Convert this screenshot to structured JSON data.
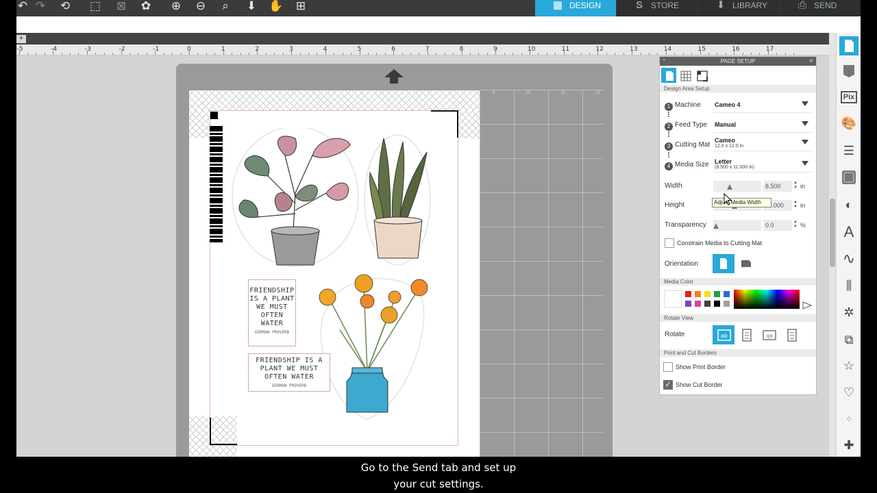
{
  "nav_tabs": [
    {
      "label": "DESIGN",
      "icon": "grid-icon",
      "active": true
    },
    {
      "label": "STORE",
      "icon": "store-s-icon",
      "active": false
    },
    {
      "label": "LIBRARY",
      "icon": "library-icon",
      "active": false
    },
    {
      "label": "SEND",
      "icon": "send-icon",
      "active": false
    }
  ],
  "toolbar_icons": [
    "undo-icon",
    "redo-icon",
    "refresh-icon",
    "select-icon",
    "deselect-icon",
    "paint-icon",
    "zoom-in-icon",
    "zoom-out-icon",
    "zoom-fit-icon",
    "move-down-icon",
    "pan-hand-icon",
    "add-page-icon"
  ],
  "ruler_labels": [
    "-5",
    "-4",
    "-3",
    "-2",
    "-1",
    "0",
    "1",
    "2",
    "3",
    "4",
    "5",
    "6",
    "7",
    "8",
    "9",
    "10",
    "11",
    "12",
    "13",
    "14",
    "15",
    "16",
    "17"
  ],
  "mat_grid_labels": [
    "9",
    "10",
    "11",
    "12"
  ],
  "artwork": {
    "quote_tall": {
      "text": "FRIENDSHIP IS A PLANT WE MUST OFTEN WATER",
      "author": "GERMAN PROVERB"
    },
    "quote_wide": {
      "text": "FRIENDSHIP IS A PLANT WE MUST OFTEN WATER",
      "author": "GERMAN PROVERB"
    }
  },
  "panel": {
    "title": "PAGE SETUP",
    "section_design_area": "Design Area Setup",
    "machine": {
      "num": "1",
      "label": "Machine",
      "value": "Cameo 4"
    },
    "feed_type": {
      "num": "2",
      "label": "Feed Type",
      "value": "Manual"
    },
    "cutting_mat": {
      "num": "3",
      "label": "Cutting Mat",
      "value": "Cameo",
      "sub": "12.0 x 12.0 in"
    },
    "media_size": {
      "num": "4",
      "label": "Media Size",
      "value": "Letter",
      "sub": "(8.500 x 11.000 in)"
    },
    "width": {
      "label": "Width",
      "value": "8.500",
      "unit": "in",
      "position": 0.33
    },
    "height": {
      "label": "Height",
      "value": "11.000",
      "unit": "in",
      "position": 0.43
    },
    "transparency": {
      "label": "Transparency",
      "value": "0.0",
      "unit": "%",
      "position": 0.0
    },
    "constrain_label": "Constrain Media to Cutting Mat",
    "orientation_label": "Orientation",
    "section_media_color": "Media Color",
    "swatches": [
      "#e02020",
      "#f08020",
      "#f0e020",
      "#20a040",
      "#2070e0",
      "#8040c0",
      "#e040a0",
      "#404040",
      "#000000",
      "#a0a0a0"
    ],
    "section_rotate_view": "Rotate View",
    "rotate_label": "Rotate",
    "section_borders": "Print and Cut Borders",
    "show_print_border": "Show Print Border",
    "show_cut_border": "Show Cut Border",
    "print_border_checked": false,
    "cut_border_checked": true,
    "tooltip": "Adjust Media Width"
  },
  "right_toolbar_icons": [
    "page-setup-icon",
    "fill-icon",
    "pixscan-icon",
    "palette-icon",
    "line-style-icon",
    "trace-icon",
    "contrast-icon",
    "text-style-icon",
    "curve-icon",
    "align-icon",
    "replicate-icon",
    "modify-icon",
    "favorites-icon",
    "offset-icon",
    "knife-dots-icon",
    "puzzle-icon"
  ],
  "subtitles": [
    "Go to the Send tab and set up",
    "your cut settings."
  ],
  "colors": {
    "accent": "#29a9d9",
    "topbar": "#3b3b3b",
    "mat": "#9a9a9a"
  }
}
